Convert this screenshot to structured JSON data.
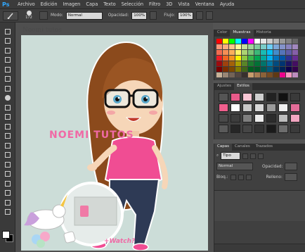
{
  "app": {
    "logo": "Ps"
  },
  "menu": [
    "Archivo",
    "Edición",
    "Imagen",
    "Capa",
    "Texto",
    "Selección",
    "Filtro",
    "3D",
    "Vista",
    "Ventana",
    "Ayuda"
  ],
  "options": {
    "brush_size": "172",
    "mode_label": "Modo:",
    "mode_value": "Normal",
    "opacity_label": "Opacidad:",
    "opacity_value": "100%",
    "flow_label": "Flujo:",
    "flow_value": "100%"
  },
  "document": {
    "title": "Noemi tutos",
    "canvas_text": "NOEMI TUTOS",
    "watch_text": "+Watch?"
  },
  "swatches_panel": {
    "tabs": [
      "Color",
      "Muestras",
      "Historia"
    ],
    "active_tab": "Muestras",
    "rows": [
      [
        "#ff0000",
        "#ffff00",
        "#00ff00",
        "#00ffff",
        "#0000ff",
        "#ff00ff",
        "#ffffff",
        "#e6e6e6",
        "#cccccc",
        "#b3b3b3",
        "#999999",
        "#808080",
        "#666666"
      ],
      [
        "#f7977a",
        "#f9ad81",
        "#fdc68a",
        "#fff79a",
        "#c4df9b",
        "#a2d39c",
        "#82ca9d",
        "#7bcdc8",
        "#6ecff6",
        "#7ea7d8",
        "#8493ca",
        "#8882be",
        "#a187be"
      ],
      [
        "#f26c4f",
        "#f68e55",
        "#fbaf5c",
        "#fff467",
        "#acd372",
        "#7cc576",
        "#3bb878",
        "#1abbb4",
        "#00bff3",
        "#438cca",
        "#5574b9",
        "#605ca8",
        "#855fa8"
      ],
      [
        "#ed1c24",
        "#f26522",
        "#f7941d",
        "#fff200",
        "#8dc73f",
        "#39b54a",
        "#00a651",
        "#00a99d",
        "#00aeef",
        "#0072bc",
        "#0054a6",
        "#2e3192",
        "#662d91"
      ],
      [
        "#9e0b0f",
        "#a0410d",
        "#a36209",
        "#aba000",
        "#598527",
        "#1a7b30",
        "#007236",
        "#00746b",
        "#0076a3",
        "#004b80",
        "#003471",
        "#1b1464",
        "#440e62"
      ],
      [
        "#790000",
        "#7b2e00",
        "#7d4900",
        "#827b00",
        "#406618",
        "#005e20",
        "#005826",
        "#005952",
        "#005b7f",
        "#003663",
        "#002157",
        "#0d004c",
        "#32004b"
      ],
      [
        "#c7b299",
        "#998675",
        "#736357",
        "#534741",
        "#37302d",
        "#c69c6d",
        "#a67c52",
        "#8c6239",
        "#754c24",
        "#603913",
        "#ec008c",
        "#f49ac1",
        "#bd8cbf"
      ]
    ]
  },
  "styles_panel": {
    "tabs": [
      "Ajustes",
      "Estilos"
    ],
    "active_tab": "Estilos",
    "styles": [
      "#555555",
      "#e85a8a",
      "#f7c6d4",
      "#cfcfcf",
      "#222222",
      "#111111",
      "#3a3a3a",
      "#f05f8d",
      "#ffffff",
      "#c8c8c8",
      "#d8d8d8",
      "#9b9b9b",
      "#f0f0f0",
      "#e36c98",
      "#4a4a4a",
      "#3d3d3d",
      "#7f7f7f",
      "#ececec",
      "#2c2c2c",
      "#bdbdbd",
      "#f2a5c0",
      "#5a5a5a",
      "#262626",
      "#464646",
      "#333333",
      "#1a1a1a",
      "#6d6d6d",
      "#3b3b3b"
    ]
  },
  "layers_panel": {
    "tabs": [
      "Capas",
      "Canales",
      "Trazados"
    ],
    "active_tab": "Capas",
    "kind_label": "Tipo",
    "blend_mode": "Normal",
    "opacity_label": "Opacidad:",
    "lock_label": "Bloq.:",
    "fill_label": "Relleno:"
  },
  "colors": {
    "accent": "#31a8ff",
    "brand_pink": "#f06aa6",
    "canvas_bg": "#ccddd8"
  }
}
